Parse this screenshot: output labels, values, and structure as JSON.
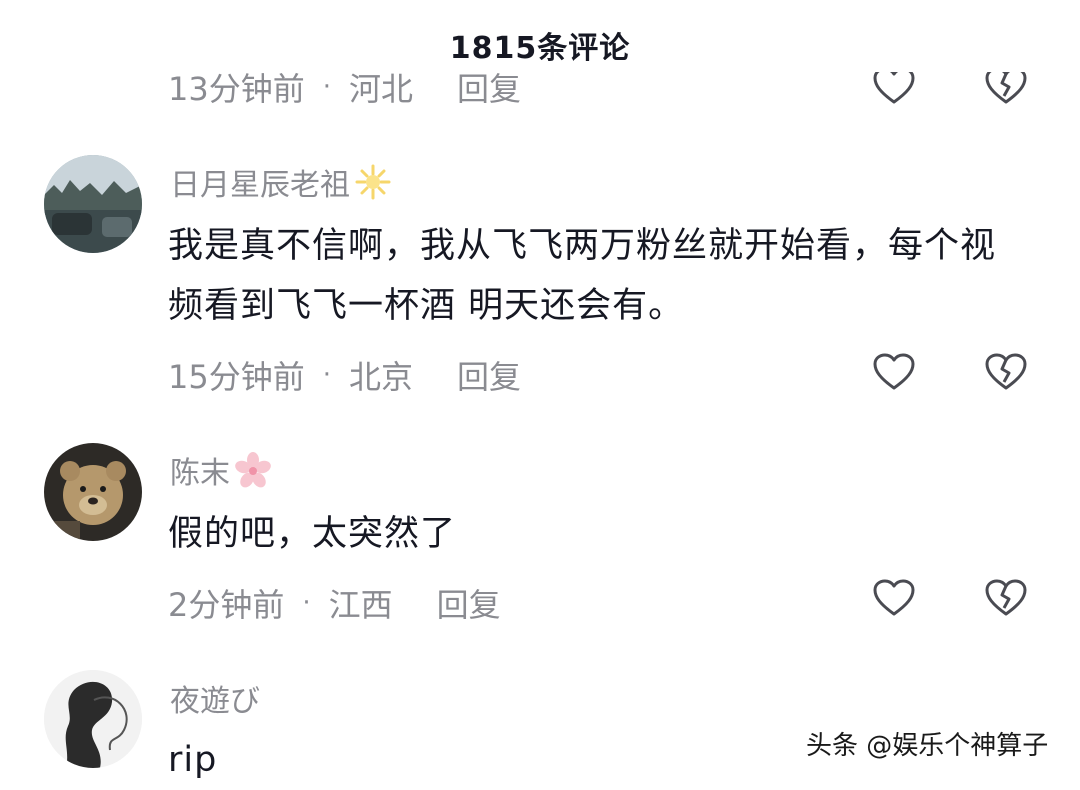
{
  "header": {
    "title": "1815条评论"
  },
  "previous": {
    "time": "13分钟前",
    "location": "河北",
    "reply": "回复"
  },
  "comments": [
    {
      "username": "日月星辰老祖",
      "badge": "sun-glow-icon",
      "text": "我是真不信啊，我从飞飞两万粉丝就开始看，每个视频看到飞飞一杯酒 明天还会有。",
      "time": "15分钟前",
      "location": "北京",
      "reply": "回复"
    },
    {
      "username": "陈末",
      "badge": "sakura-icon",
      "text": "假的吧，太突然了",
      "time": "2分钟前",
      "location": "江西",
      "reply": "回复"
    },
    {
      "username": "夜遊び",
      "text": "rip"
    }
  ],
  "watermark": "头条 @娱乐个神算子",
  "colors": {
    "text": "#161823",
    "secondary": "#8a8b91",
    "background": "#ffffff"
  }
}
